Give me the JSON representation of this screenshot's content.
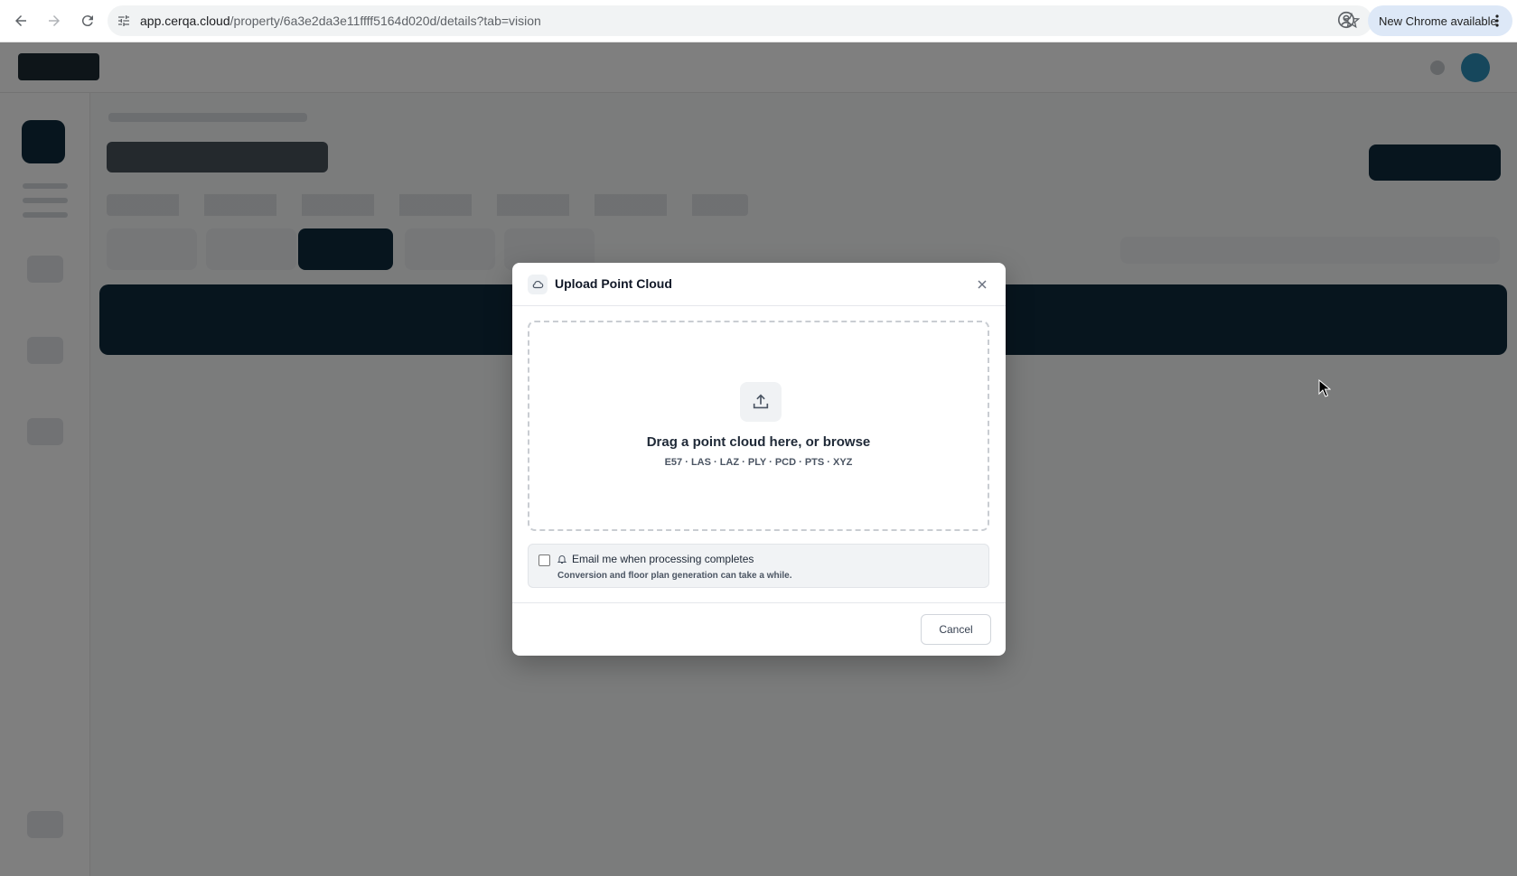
{
  "browser": {
    "url_host": "app.cerqa.cloud",
    "url_path": "/property/6a3e2da3e11ffff5164d020d/details?tab=vision",
    "update_chip_label": "New Chrome available"
  },
  "modal": {
    "title": "Upload Point Cloud",
    "dropzone": {
      "title": "Drag a point cloud here, or browse",
      "formats": "E57 · LAS · LAZ · PLY · PCD · PTS · XYZ"
    },
    "notify": {
      "checked": false,
      "label": "Email me when processing completes",
      "sublabel": "Conversion and floor plan generation can take a while."
    },
    "cancel_label": "Cancel"
  },
  "colors": {
    "overlay": "rgba(0,0,0,0.5)",
    "brand_dark": "#0f2a3c",
    "chrome_chip": "#dde8f7"
  },
  "icons": {
    "back": "arrow-left-icon",
    "forward": "arrow-right-icon",
    "reload": "reload-icon",
    "site_settings": "tune-icon",
    "bookmark": "star-icon",
    "profile": "account-circle-icon",
    "menu": "more-vert-icon",
    "modal_header": "cloud-icon",
    "close": "close-icon",
    "upload": "upload-icon",
    "notify": "bell-icon"
  }
}
